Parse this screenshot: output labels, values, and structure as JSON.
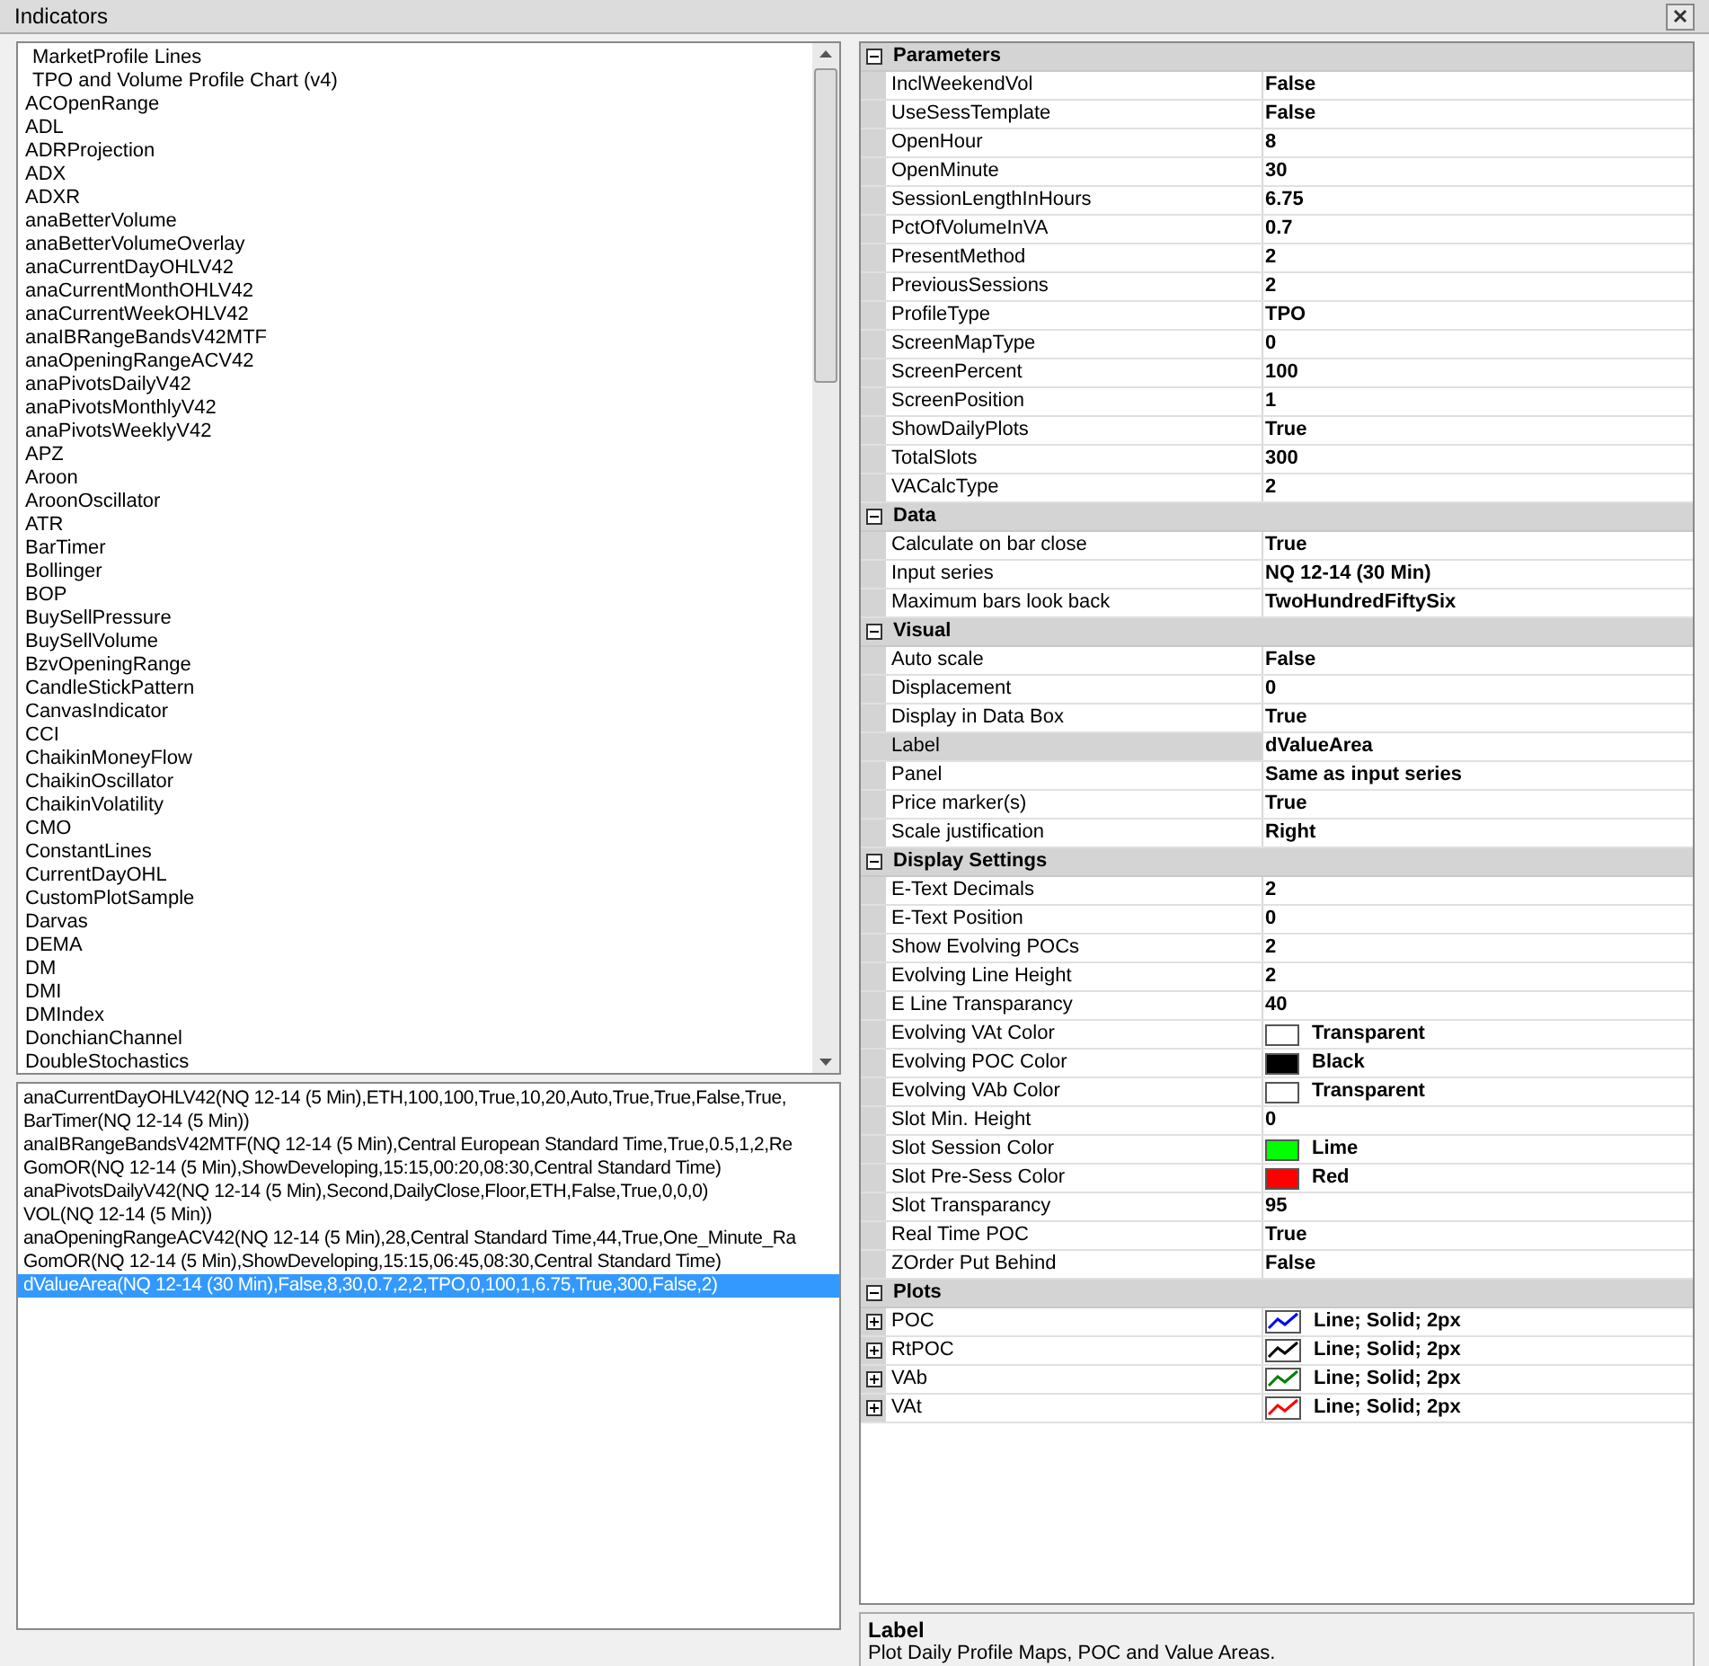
{
  "window": {
    "title": "Indicators"
  },
  "indicator_list": {
    "items": [
      "MarketProfile Lines",
      "TPO and Volume Profile Chart (v4)",
      "ACOpenRange",
      "ADL",
      "ADRProjection",
      "ADX",
      "ADXR",
      "anaBetterVolume",
      "anaBetterVolumeOverlay",
      "anaCurrentDayOHLV42",
      "anaCurrentMonthOHLV42",
      "anaCurrentWeekOHLV42",
      "anaIBRangeBandsV42MTF",
      "anaOpeningRangeACV42",
      "anaPivotsDailyV42",
      "anaPivotsMonthlyV42",
      "anaPivotsWeeklyV42",
      "APZ",
      "Aroon",
      "AroonOscillator",
      "ATR",
      "BarTimer",
      "Bollinger",
      "BOP",
      "BuySellPressure",
      "BuySellVolume",
      "BzvOpeningRange",
      "CandleStickPattern",
      "CanvasIndicator",
      "CCI",
      "ChaikinMoneyFlow",
      "ChaikinOscillator",
      "ChaikinVolatility",
      "CMO",
      "ConstantLines",
      "CurrentDayOHL",
      "CustomPlotSample",
      "Darvas",
      "DEMA",
      "DM",
      "DMI",
      "DMIndex",
      "DonchianChannel",
      "DoubleStochastics"
    ]
  },
  "applied_list": {
    "items": [
      {
        "text": "anaCurrentDayOHLV42(NQ 12-14 (5 Min),ETH,100,100,True,10,20,Auto,True,True,False,True,",
        "selected": false
      },
      {
        "text": "BarTimer(NQ 12-14 (5 Min))",
        "selected": false
      },
      {
        "text": "anaIBRangeBandsV42MTF(NQ 12-14 (5 Min),Central European Standard Time,True,0.5,1,2,Re",
        "selected": false
      },
      {
        "text": "GomOR(NQ 12-14 (5 Min),ShowDeveloping,15:15,00:20,08:30,Central Standard Time)",
        "selected": false
      },
      {
        "text": "anaPivotsDailyV42(NQ 12-14 (5 Min),Second,DailyClose,Floor,ETH,False,True,0,0,0)",
        "selected": false
      },
      {
        "text": "VOL(NQ 12-14 (5 Min))",
        "selected": false
      },
      {
        "text": "anaOpeningRangeACV42(NQ 12-14 (5 Min),28,Central Standard Time,44,True,One_Minute_Ra",
        "selected": false
      },
      {
        "text": "GomOR(NQ 12-14 (5 Min),ShowDeveloping,15:15,06:45,08:30,Central Standard Time)",
        "selected": false
      },
      {
        "text": "dValueArea(NQ 12-14 (30 Min),False,8,30,0.7,2,2,TPO,0,100,1,6.75,True,300,False,2)",
        "selected": true
      }
    ]
  },
  "property_grid": {
    "categories": [
      {
        "name": "Parameters",
        "expanded": true,
        "rows": [
          {
            "name": "InclWeekendVol",
            "value": "False",
            "selected": false
          },
          {
            "name": "UseSessTemplate",
            "value": "False",
            "selected": false
          },
          {
            "name": "OpenHour",
            "value": "8",
            "selected": false
          },
          {
            "name": "OpenMinute",
            "value": "30",
            "selected": false
          },
          {
            "name": "SessionLengthInHours",
            "value": "6.75",
            "selected": false
          },
          {
            "name": "PctOfVolumeInVA",
            "value": "0.7",
            "selected": false
          },
          {
            "name": "PresentMethod",
            "value": "2",
            "selected": false
          },
          {
            "name": "PreviousSessions",
            "value": "2",
            "selected": false
          },
          {
            "name": "ProfileType",
            "value": "TPO",
            "selected": false
          },
          {
            "name": "ScreenMapType",
            "value": "0",
            "selected": false
          },
          {
            "name": "ScreenPercent",
            "value": "100",
            "selected": false
          },
          {
            "name": "ScreenPosition",
            "value": "1",
            "selected": false
          },
          {
            "name": "ShowDailyPlots",
            "value": "True",
            "selected": false
          },
          {
            "name": "TotalSlots",
            "value": "300",
            "selected": false
          },
          {
            "name": "VACalcType",
            "value": "2",
            "selected": false
          }
        ]
      },
      {
        "name": "Data",
        "expanded": true,
        "rows": [
          {
            "name": "Calculate on bar close",
            "value": "True",
            "selected": false
          },
          {
            "name": "Input series",
            "value": "NQ 12-14 (30 Min)",
            "selected": false
          },
          {
            "name": "Maximum bars look back",
            "value": "TwoHundredFiftySix",
            "selected": false
          }
        ]
      },
      {
        "name": "Visual",
        "expanded": true,
        "rows": [
          {
            "name": "Auto scale",
            "value": "False",
            "selected": false
          },
          {
            "name": "Displacement",
            "value": "0",
            "selected": false
          },
          {
            "name": "Display in Data Box",
            "value": "True",
            "selected": false
          },
          {
            "name": "Label",
            "value": "dValueArea",
            "selected": true
          },
          {
            "name": "Panel",
            "value": "Same as input series",
            "selected": false
          },
          {
            "name": "Price marker(s)",
            "value": "True",
            "selected": false
          },
          {
            "name": "Scale justification",
            "value": "Right",
            "selected": false
          }
        ]
      },
      {
        "name": "Display Settings",
        "expanded": true,
        "rows": [
          {
            "name": "E-Text Decimals",
            "value": "2",
            "selected": false
          },
          {
            "name": "E-Text Position",
            "value": "0",
            "selected": false
          },
          {
            "name": "Show Evolving POCs",
            "value": "2",
            "selected": false
          },
          {
            "name": "Evolving Line Height",
            "value": "2",
            "selected": false
          },
          {
            "name": "E Line Transparancy",
            "value": "40",
            "selected": false
          },
          {
            "name": "Evolving VAt Color",
            "value": "Transparent",
            "kind": "color",
            "color": "#ffffff",
            "selected": false
          },
          {
            "name": "Evolving POC Color",
            "value": "Black",
            "kind": "color",
            "color": "#000000",
            "selected": false
          },
          {
            "name": "Evolving VAb Color",
            "value": "Transparent",
            "kind": "color",
            "color": "#ffffff",
            "selected": false
          },
          {
            "name": "Slot Min. Height",
            "value": "0",
            "selected": false
          },
          {
            "name": "Slot Session Color",
            "value": "Lime",
            "kind": "color",
            "color": "#00ff00",
            "selected": false
          },
          {
            "name": "Slot Pre-Sess Color",
            "value": "Red",
            "kind": "color",
            "color": "#ff0000",
            "selected": false
          },
          {
            "name": "Slot Transparancy",
            "value": "95",
            "selected": false
          },
          {
            "name": "Real Time POC",
            "value": "True",
            "selected": false
          },
          {
            "name": "ZOrder Put Behind",
            "value": "False",
            "selected": false
          }
        ]
      },
      {
        "name": "Plots",
        "expanded": true,
        "rows": [
          {
            "name": "POC",
            "value": "Line; Solid; 2px",
            "kind": "plot",
            "color": "#0000ff",
            "expanded": false,
            "selected": false
          },
          {
            "name": "RtPOC",
            "value": "Line; Solid; 2px",
            "kind": "plot",
            "color": "#000000",
            "expanded": false,
            "selected": false
          },
          {
            "name": "VAb",
            "value": "Line; Solid; 2px",
            "kind": "plot",
            "color": "#008000",
            "expanded": false,
            "selected": false
          },
          {
            "name": "VAt",
            "value": "Line; Solid; 2px",
            "kind": "plot",
            "color": "#ff0000",
            "expanded": false,
            "selected": false
          }
        ]
      }
    ]
  },
  "description": {
    "title": "Label",
    "text": "Plot Daily Profile Maps, POC and Value Areas."
  }
}
